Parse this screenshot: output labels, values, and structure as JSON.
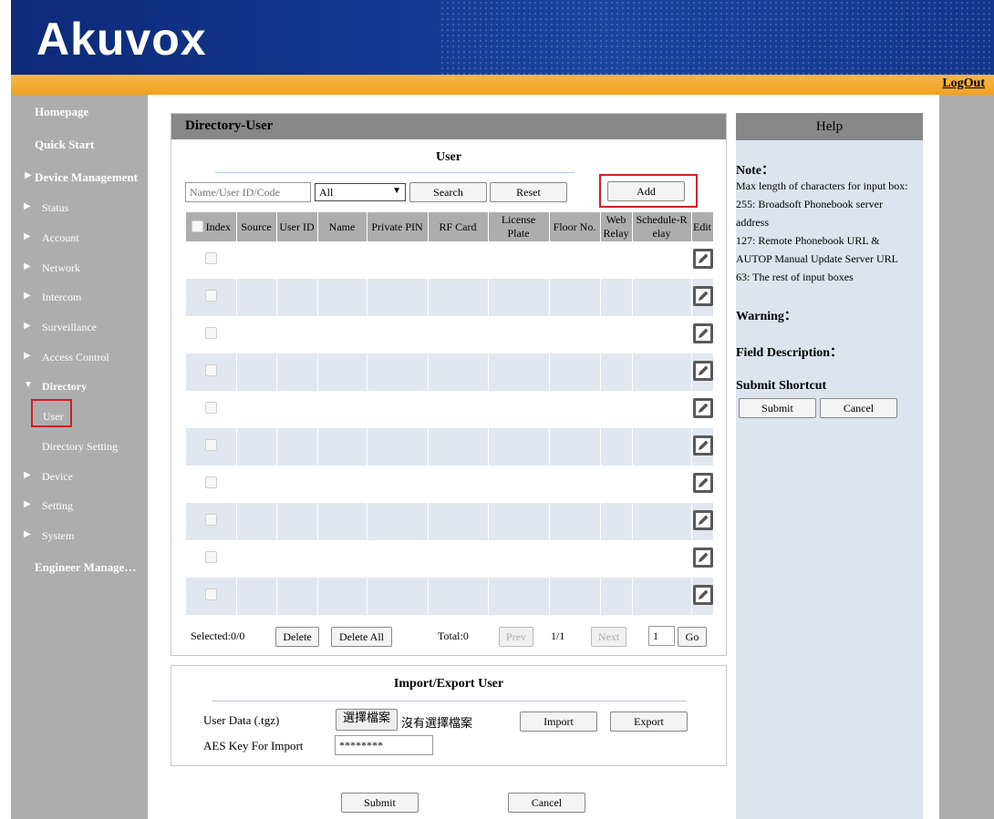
{
  "header": {
    "logo": "Akuvox",
    "logout": "LogOut"
  },
  "sidebar": {
    "items": [
      {
        "label": "Homepage"
      },
      {
        "label": "Quick Start"
      },
      {
        "label": "Device Management"
      },
      {
        "label": "Status"
      },
      {
        "label": "Account"
      },
      {
        "label": "Network"
      },
      {
        "label": "Intercom"
      },
      {
        "label": "Surveillance"
      },
      {
        "label": "Access Control"
      },
      {
        "label": "Directory"
      },
      {
        "label": "User"
      },
      {
        "label": "Directory Setting"
      },
      {
        "label": "Device"
      },
      {
        "label": "Setting"
      },
      {
        "label": "System"
      },
      {
        "label": "Engineer Manage…"
      }
    ]
  },
  "panel": {
    "title": "Directory-User",
    "section": "User",
    "search_placeholder": "Name/User ID/Code",
    "filter_value": "All",
    "search_btn": "Search",
    "reset_btn": "Reset",
    "add_btn": "Add",
    "columns": [
      "Index",
      "Source",
      "User ID",
      "Name",
      "Private PIN",
      "RF Card",
      "License Plate",
      "Floor No.",
      "Web Relay",
      "Schedule-Relay",
      "Edit"
    ],
    "col_license_1": "License",
    "col_license_2": "Plate",
    "col_web_1": "Web",
    "col_web_2": "Relay",
    "col_sched_1": "Schedule-R",
    "col_sched_2": "elay",
    "selected": "Selected:0/0",
    "delete_btn": "Delete",
    "delete_all_btn": "Delete All",
    "total": "Total:0",
    "prev_btn": "Prev",
    "page": "1/1",
    "next_btn": "Next",
    "page_input": "1",
    "go_btn": "Go"
  },
  "import_export": {
    "title": "Import/Export User",
    "user_data_label": "User Data (.tgz)",
    "choose_file_btn": "選擇檔案",
    "no_file_text": "沒有選擇檔案",
    "import_btn": "Import",
    "export_btn": "Export",
    "aes_label": "AES Key For Import",
    "aes_value": "********"
  },
  "footer": {
    "submit_btn": "Submit",
    "cancel_btn": "Cancel"
  },
  "help": {
    "title": "Help",
    "note_heading": "Note：",
    "note_lines": [
      "Max length of characters for input box:",
      "255: Broadsoft Phonebook server",
      "address",
      "127: Remote Phonebook URL &",
      "AUTOP Manual Update Server URL",
      "63: The rest of input boxes"
    ],
    "warning_heading": "Warning：",
    "field_heading": "Field Description：",
    "shortcut_heading": "Submit Shortcut",
    "submit_btn": "Submit",
    "cancel_btn": "Cancel"
  }
}
